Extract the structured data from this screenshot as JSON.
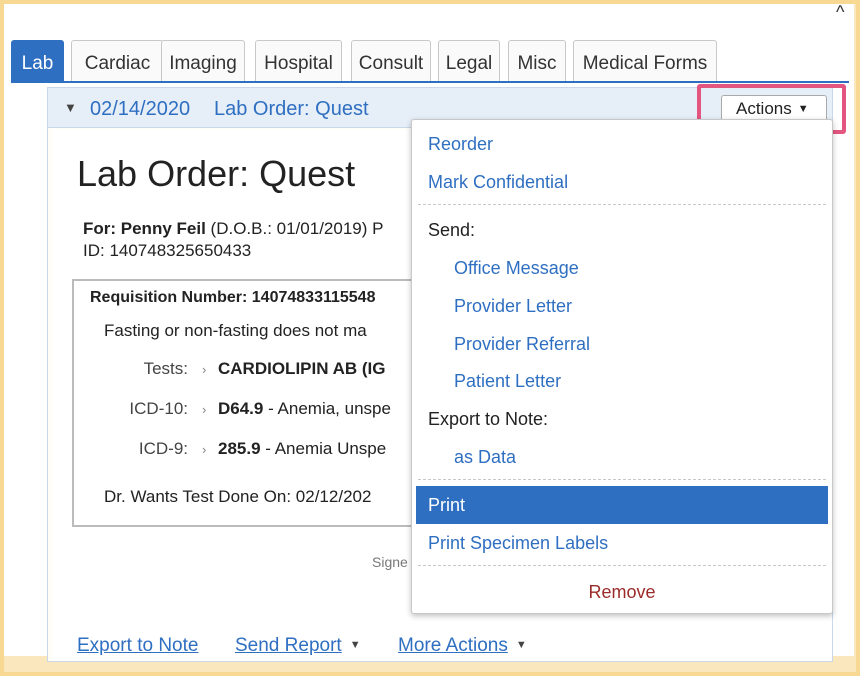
{
  "top_caret": "^",
  "tabs": [
    {
      "label": "Lab"
    },
    {
      "label": "Cardiac"
    },
    {
      "label": "Imaging"
    },
    {
      "label": "Hospital"
    },
    {
      "label": "Consult"
    },
    {
      "label": "Legal"
    },
    {
      "label": "Misc"
    },
    {
      "label": "Medical Forms"
    }
  ],
  "header": {
    "date": "02/14/2020",
    "title": "Lab Order: Quest",
    "actions_label": "Actions"
  },
  "order": {
    "title": "Lab Order: Quest",
    "for_label": "For: Penny Feil",
    "dob_text": "(D.O.B.: 01/01/2019) P",
    "id_text": "ID: 140748325650433",
    "requisition": "Requisition Number: 14074833115548",
    "fasting": "Fasting or non-fasting does not ma",
    "tests_label": "Tests:",
    "tests_value": "CARDIOLIPIN AB (IG",
    "icd10_label": "ICD-10:",
    "icd10_code": "D64.9",
    "icd10_desc": " - Anemia, unspe",
    "icd9_label": "ICD-9:",
    "icd9_code": "285.9",
    "icd9_desc": " - Anemia Unspe",
    "wants": "Dr. Wants Test Done On: 02/12/202",
    "signed": "Signe"
  },
  "footer": {
    "export": "Export to Note",
    "send_report": "Send Report",
    "more_actions": "More Actions"
  },
  "menu": {
    "reorder": "Reorder",
    "mark_confidential": "Mark Confidential",
    "send_header": "Send:",
    "office_message": "Office Message",
    "provider_letter": "Provider Letter",
    "provider_referral": "Provider Referral",
    "patient_letter": "Patient Letter",
    "export_header": "Export to Note:",
    "as_data": "as Data",
    "print": "Print",
    "print_labels": "Print Specimen Labels",
    "remove": "Remove"
  },
  "colors": {
    "accent": "#2f6fc1",
    "highlight": "#e4567f",
    "remove": "#9b2a2a",
    "frame": "#fbe7bd"
  }
}
